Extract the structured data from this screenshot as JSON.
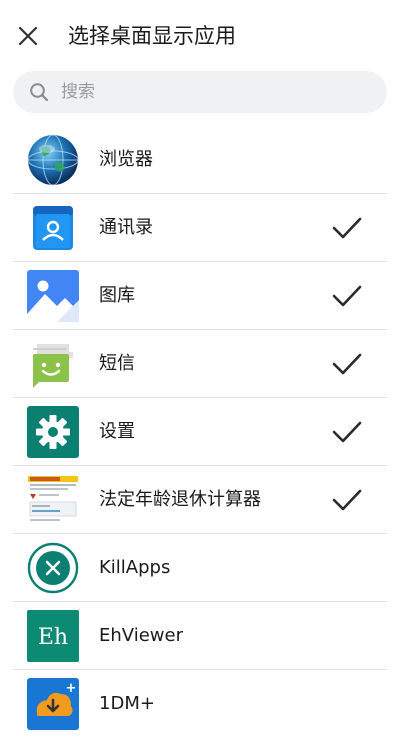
{
  "header": {
    "close_icon": "close-icon",
    "title": "选择桌面显示应用"
  },
  "search": {
    "icon": "search-icon",
    "placeholder": "搜索",
    "value": ""
  },
  "apps": [
    {
      "label": "浏览器",
      "icon": "globe-icon",
      "checked": false
    },
    {
      "label": "通讯录",
      "icon": "contacts-icon",
      "checked": true
    },
    {
      "label": "图库",
      "icon": "gallery-icon",
      "checked": true
    },
    {
      "label": "短信",
      "icon": "messages-icon",
      "checked": true
    },
    {
      "label": "设置",
      "icon": "settings-gear-icon",
      "checked": true
    },
    {
      "label": "法定年龄退休计算器",
      "icon": "retirement-calculator-thumbnail-icon",
      "checked": true
    },
    {
      "label": "KillApps",
      "icon": "killapps-icon",
      "checked": false
    },
    {
      "label": "EhViewer",
      "icon": "ehviewer-icon",
      "icon_text": "Eh",
      "checked": false
    },
    {
      "label": "1DM+",
      "icon": "1dm-download-icon",
      "checked": false
    }
  ],
  "colors": {
    "accent_teal": "#0a7f72",
    "contacts_blue": "#1e88e5",
    "gallery_blue": "#4285f4",
    "messages_green": "#8bc34a",
    "ehviewer_teal": "#0d8a73",
    "onedm_orange": "#f39b1f",
    "check": "#2a2a2a",
    "search_bg": "#eff1f3"
  }
}
